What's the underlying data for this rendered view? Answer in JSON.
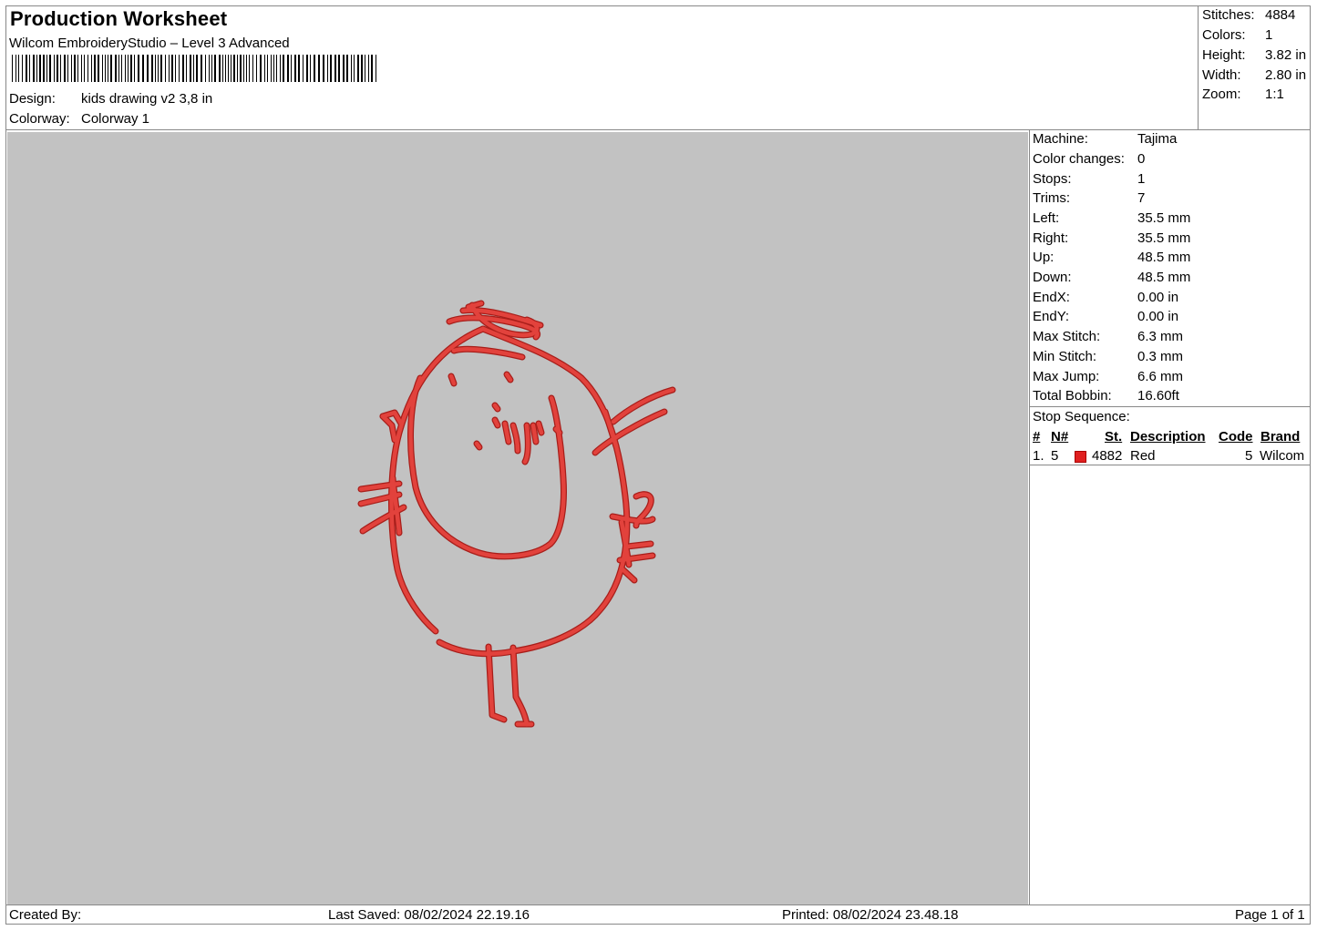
{
  "header": {
    "title": "Production Worksheet",
    "subtitle": "Wilcom EmbroideryStudio – Level 3 Advanced",
    "design_label": "Design:",
    "design_value": "kids drawing v2 3,8 in",
    "colorway_label": "Colorway:",
    "colorway_value": "Colorway 1"
  },
  "summary": [
    {
      "label": "Stitches:",
      "value": "4884"
    },
    {
      "label": "Colors:",
      "value": "1"
    },
    {
      "label": "Height:",
      "value": "3.82 in"
    },
    {
      "label": "Width:",
      "value": "2.80 in"
    },
    {
      "label": "Zoom:",
      "value": "1:1"
    }
  ],
  "machine_info": [
    {
      "label": "Machine:",
      "value": "Tajima"
    },
    {
      "label": "Color changes:",
      "value": "0"
    },
    {
      "label": "Stops:",
      "value": "1"
    },
    {
      "label": "Trims:",
      "value": "7"
    },
    {
      "label": "Left:",
      "value": "35.5 mm"
    },
    {
      "label": "Right:",
      "value": "35.5 mm"
    },
    {
      "label": "Up:",
      "value": "48.5 mm"
    },
    {
      "label": "Down:",
      "value": "48.5 mm"
    },
    {
      "label": "EndX:",
      "value": "0.00 in"
    },
    {
      "label": "EndY:",
      "value": "0.00 in"
    },
    {
      "label": "Max Stitch:",
      "value": "6.3 mm"
    },
    {
      "label": "Min Stitch:",
      "value": "0.3 mm"
    },
    {
      "label": "Max Jump:",
      "value": "6.6 mm"
    },
    {
      "label": "Total Bobbin:",
      "value": "16.60ft"
    }
  ],
  "stop_sequence": {
    "title": "Stop Sequence:",
    "headers": {
      "index": "#",
      "needle": "N#",
      "st": "St.",
      "description": "Description",
      "code": "Code",
      "brand": "Brand"
    },
    "rows": [
      {
        "index": "1.",
        "needle": "5",
        "st": "4882",
        "description": "Red",
        "code": "5",
        "brand": "Wilcom",
        "color": "#e02020"
      }
    ]
  },
  "preview": {
    "background": "#c2c2c2",
    "thread_color": "#e2423c"
  },
  "footer": {
    "created_by": "Created By:",
    "last_saved": "Last Saved: 08/02/2024 22.19.16",
    "printed": "Printed: 08/02/2024 23.48.18",
    "page": "Page 1 of 1"
  }
}
